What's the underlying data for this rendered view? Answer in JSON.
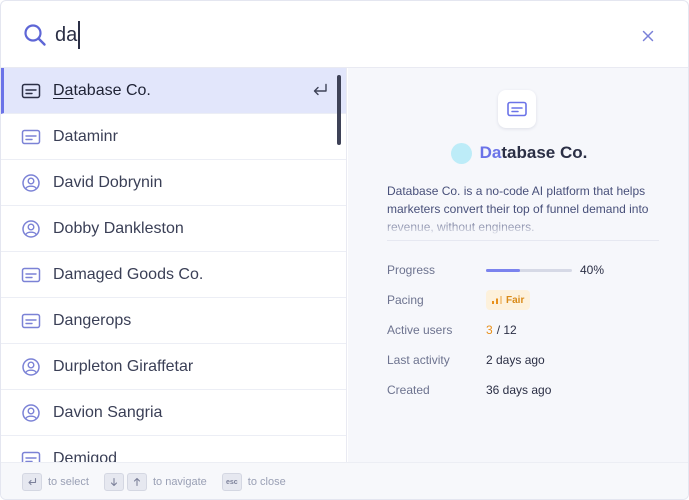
{
  "search": {
    "query": "da"
  },
  "results": [
    {
      "type": "company",
      "icon": "company-card-icon",
      "match": "Da",
      "rest": "tabase Co."
    },
    {
      "type": "company",
      "icon": "company-card-icon",
      "match": "Da",
      "rest": "taminr"
    },
    {
      "type": "person",
      "icon": "person-icon",
      "match": "Da",
      "rest": "vid Dobrynin"
    },
    {
      "type": "person",
      "icon": "person-icon",
      "match": "",
      "rest": "Dobby Dankleston"
    },
    {
      "type": "company",
      "icon": "company-card-icon",
      "match": "Da",
      "rest": "maged Goods Co."
    },
    {
      "type": "company",
      "icon": "company-card-icon",
      "match": "Da",
      "rest": "ngerops"
    },
    {
      "type": "person",
      "icon": "person-icon",
      "match": "",
      "rest": "Durpleton Giraffetar"
    },
    {
      "type": "person",
      "icon": "person-icon",
      "match": "Da",
      "rest": "vion Sangria"
    },
    {
      "type": "company",
      "icon": "company-card-icon",
      "match": "",
      "rest": "Demigod"
    }
  ],
  "detail": {
    "title_match": "Da",
    "title_rest": "tabase Co.",
    "description": "Database Co. is a no-code AI platform that helps marketers convert their top of funnel demand into revenue, without engineers.",
    "props": {
      "progress_label": "Progress",
      "progress_value": 0.4,
      "progress_text": "40%",
      "pacing_label": "Pacing",
      "pacing_value": "Fair",
      "active_users_label": "Active users",
      "active_users_count": "3",
      "active_users_total": "/ 12",
      "last_activity_label": "Last activity",
      "last_activity_value": "2 days ago",
      "created_label": "Created",
      "created_value": "36 days ago"
    }
  },
  "footer": {
    "select_text": "to select",
    "navigate_text": "to navigate",
    "esc_key": "esc",
    "close_text": "to close"
  },
  "colors": {
    "accent": "#6b73e8",
    "selected_bg": "#e2e6fb",
    "pacing_fair": "#d98a18",
    "avatar": "#bdecf8"
  }
}
